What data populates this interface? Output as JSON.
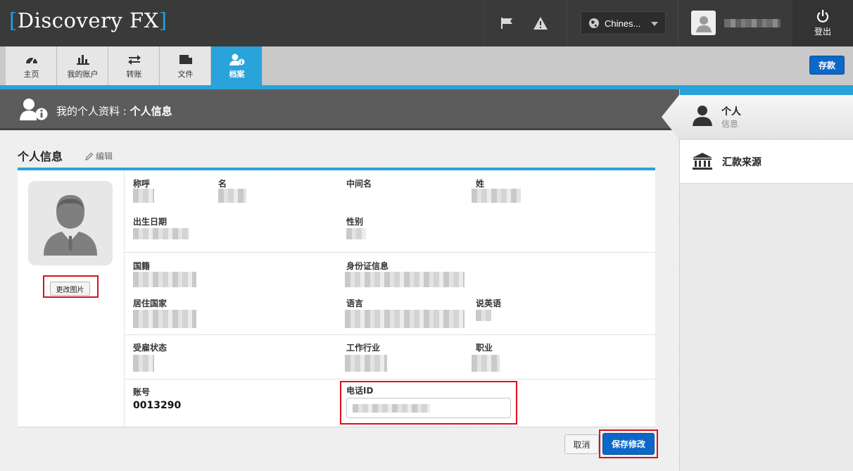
{
  "app": {
    "logo_text": "Discovery FX"
  },
  "topbar": {
    "language": "Chines...",
    "logout_label": "登出",
    "icons": [
      "flag-icon",
      "warning-icon",
      "globe-icon",
      "user-icon",
      "power-icon"
    ]
  },
  "nav": {
    "items": [
      {
        "label": "主页",
        "icon": "dashboard-icon"
      },
      {
        "label": "我的账户",
        "icon": "bar-chart-icon"
      },
      {
        "label": "转账",
        "icon": "transfer-icon"
      },
      {
        "label": "文件",
        "icon": "folder-icon"
      },
      {
        "label": "档案",
        "icon": "profile-icon",
        "active": true
      }
    ],
    "deposit_label": "存款"
  },
  "header": {
    "prefix": "我的个人资料 : ",
    "title": "个人信息"
  },
  "section": {
    "title": "个人信息",
    "edit_label": "编辑"
  },
  "profile": {
    "change_photo_label": "更改图片",
    "fields": {
      "salutation": "称呼",
      "first_name": "名",
      "middle_name": "中间名",
      "last_name": "姓",
      "dob": "出生日期",
      "gender": "性别",
      "nationality": "国籍",
      "id_info": "身份证信息",
      "country_of_residence": "居住国家",
      "language": "语言",
      "speaks_english": "说英语",
      "employment_status": "受雇状态",
      "industry": "工作行业",
      "occupation": "职业",
      "account_no": "账号",
      "phone_id": "电话ID"
    },
    "account_no_value": "0013290"
  },
  "actions": {
    "cancel_label": "取消",
    "save_label": "保存修改"
  },
  "sidebar": {
    "items": [
      {
        "title": "个人",
        "subtitle": "信息",
        "icon": "person-icon",
        "active": true
      },
      {
        "title": "汇款来源",
        "icon": "bank-icon"
      }
    ]
  },
  "colors": {
    "accent": "#29a3da",
    "primary_button": "#0d67c9",
    "highlight_box": "#d9121c",
    "topbar": "#3a3a3a"
  }
}
